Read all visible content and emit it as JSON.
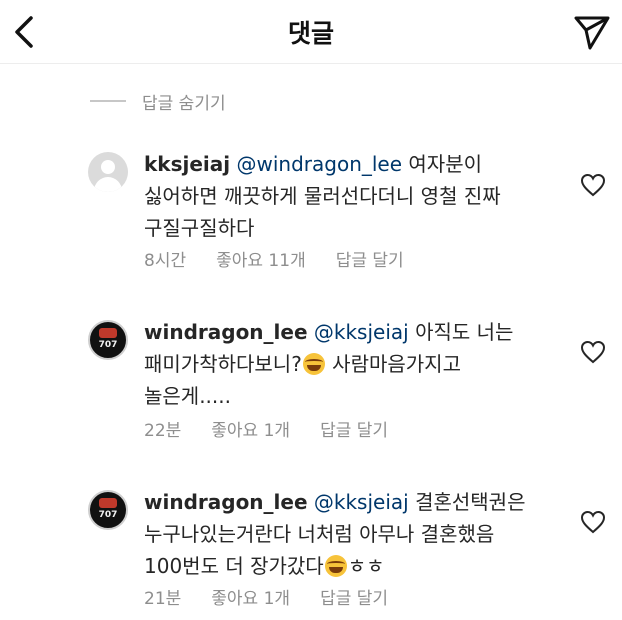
{
  "header": {
    "title": "댓글"
  },
  "hide_replies": {
    "label": "답글 숨기기"
  },
  "comments": [
    {
      "username": "kksjeiaj",
      "mention": "@windragon_lee",
      "text": " 여자분이 싫어하면 깨끗하게 물러선다더니 영철 진짜 구질구질하다",
      "time": "8시간",
      "likes": "좋아요 11개",
      "reply": "답글 달기"
    },
    {
      "username": "windragon_lee",
      "mention": "@kksjeiaj",
      "text_before": " 아직도 너는 패미가착하다보니?",
      "text_after": " 사람마음가지고 놀은게.....",
      "time": "22분",
      "likes": "좋아요 1개",
      "reply": "답글 달기",
      "avatar_text": "707"
    },
    {
      "username": "windragon_lee",
      "mention": "@kksjeiaj",
      "text_before": " 결혼선택권은 누구나있는거란다 너처럼 아무나 결혼했음 100번도 더 장가갔다",
      "text_after": "ㅎㅎ",
      "time": "21분",
      "likes": "좋아요 1개",
      "reply": "답글 달기",
      "avatar_text": "707"
    }
  ],
  "icons": {
    "back": "chevron-left-icon",
    "send": "paper-plane-icon",
    "like": "heart-icon",
    "emoji": "face-with-tears-of-joy"
  }
}
